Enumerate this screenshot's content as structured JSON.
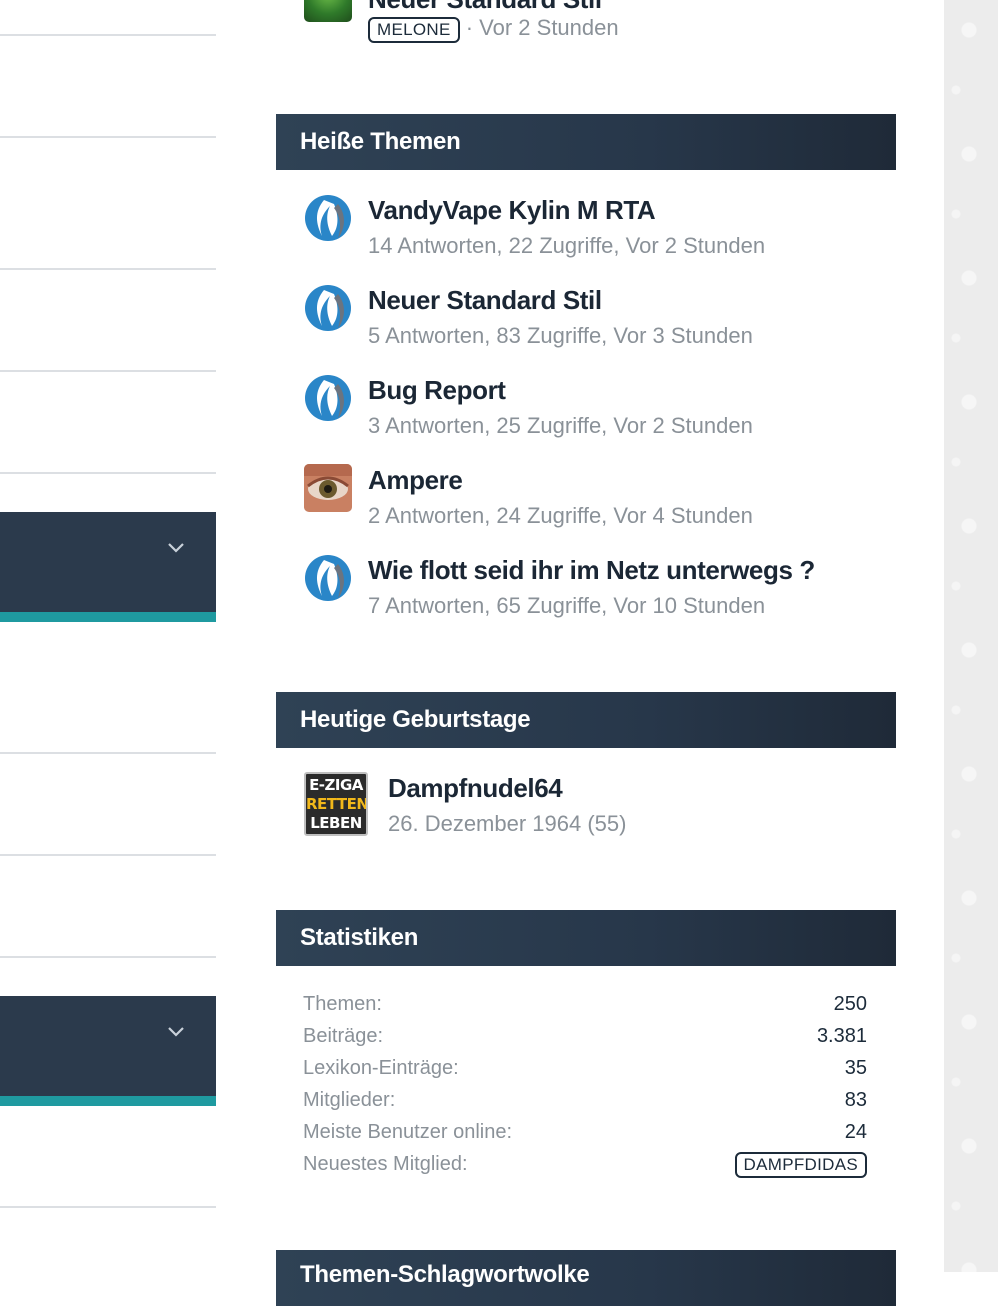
{
  "previous_item": {
    "title": "Neuer Standard Stil",
    "tag": "MELONE",
    "time": "· Vor 2 Stunden"
  },
  "hot_topics": {
    "heading": "Heiße Themen",
    "items": [
      {
        "title": "VandyVape Kylin M RTA",
        "meta": "14 Antworten, 22 Zugriffe, Vor 2 Stunden",
        "avatar": "flame-logo-icon"
      },
      {
        "title": "Neuer Standard Stil",
        "meta": "5 Antworten, 83 Zugriffe, Vor 3 Stunden",
        "avatar": "flame-logo-icon"
      },
      {
        "title": "Bug Report",
        "meta": "3 Antworten, 25 Zugriffe, Vor 2 Stunden",
        "avatar": "flame-logo-icon"
      },
      {
        "title": "Ampere",
        "meta": "2 Antworten, 24 Zugriffe, Vor 4 Stunden",
        "avatar": "eye-photo"
      },
      {
        "title": "Wie flott seid ihr im Netz unterwegs ?",
        "meta": "7 Antworten, 65 Zugriffe, Vor 10 Stunden",
        "avatar": "flame-logo-icon"
      }
    ]
  },
  "birthdays": {
    "heading": "Heutige Geburtstage",
    "user": "Dampfnudel64",
    "date": "26. Dezember 1964 (55)",
    "avatar_lines": [
      "E-ZIGA",
      "RETTEN",
      "LEBEN"
    ]
  },
  "statistics": {
    "heading": "Statistiken",
    "rows": [
      {
        "label": "Themen:",
        "value": "250"
      },
      {
        "label": "Beiträge:",
        "value": "3.381"
      },
      {
        "label": "Lexikon-Einträge:",
        "value": "35"
      },
      {
        "label": "Mitglieder:",
        "value": "83"
      },
      {
        "label": "Meiste Benutzer online:",
        "value": "24"
      },
      {
        "label": "Neuestes Mitglied:",
        "value": "DAMPFDIDAS"
      }
    ]
  },
  "next_box": {
    "heading": "Themen-Schlagwortwolke"
  },
  "colors": {
    "header_bg": "#2b3a4c",
    "accent": "#1f9aa0",
    "muted_text": "#8a9198"
  }
}
